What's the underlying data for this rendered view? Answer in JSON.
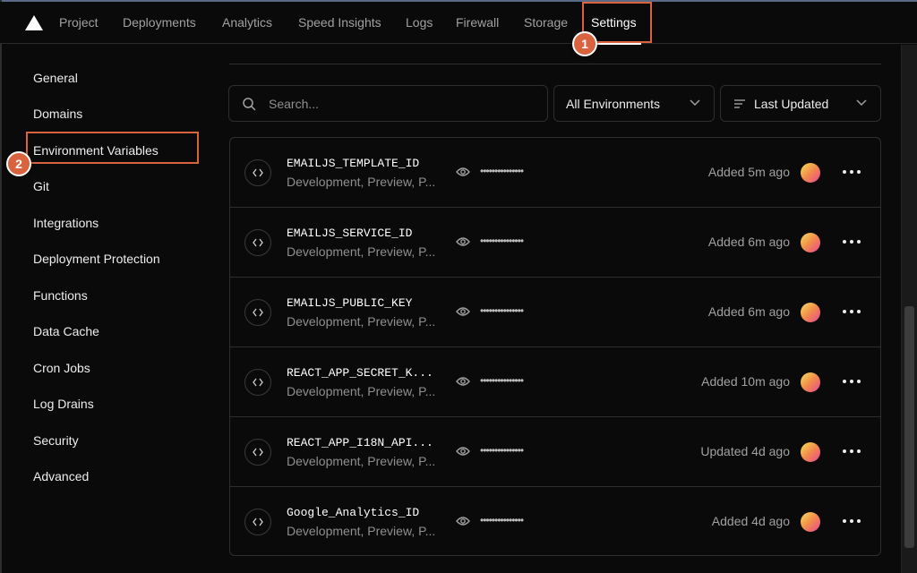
{
  "nav": {
    "tabs": [
      "Project",
      "Deployments",
      "Analytics",
      "Speed Insights",
      "Logs",
      "Firewall",
      "Storage",
      "Settings"
    ],
    "active": "Settings"
  },
  "annotations": [
    "1",
    "2"
  ],
  "sidebar": {
    "items": [
      "General",
      "Domains",
      "Environment Variables",
      "Git",
      "Integrations",
      "Deployment Protection",
      "Functions",
      "Data Cache",
      "Cron Jobs",
      "Log Drains",
      "Security",
      "Advanced"
    ],
    "active": "Environment Variables"
  },
  "filters": {
    "search_placeholder": "Search...",
    "environment": "All Environments",
    "sort": "Last Updated"
  },
  "variables": [
    {
      "name": "EMAILJS_TEMPLATE_ID",
      "environments": "Development, Preview, P...",
      "masked": "•••••••••••••••",
      "status": "Added 5m ago"
    },
    {
      "name": "EMAILJS_SERVICE_ID",
      "environments": "Development, Preview, P...",
      "masked": "•••••••••••••••",
      "status": "Added 6m ago"
    },
    {
      "name": "EMAILJS_PUBLIC_KEY",
      "environments": "Development, Preview, P...",
      "masked": "•••••••••••••••",
      "status": "Added 6m ago"
    },
    {
      "name": "REACT_APP_SECRET_K...",
      "environments": "Development, Preview, P...",
      "masked": "•••••••••••••••",
      "status": "Added 10m ago"
    },
    {
      "name": "REACT_APP_I18N_API...",
      "environments": "Development, Preview, P...",
      "masked": "•••••••••••••••",
      "status": "Updated 4d ago"
    },
    {
      "name": "Google_Analytics_ID",
      "environments": "Development, Preview, P...",
      "masked": "•••••••••••••••",
      "status": "Added 4d ago"
    }
  ],
  "colors": {
    "callout": "#d9623f",
    "background": "#0a0a0a",
    "border": "#2e2e2e"
  }
}
